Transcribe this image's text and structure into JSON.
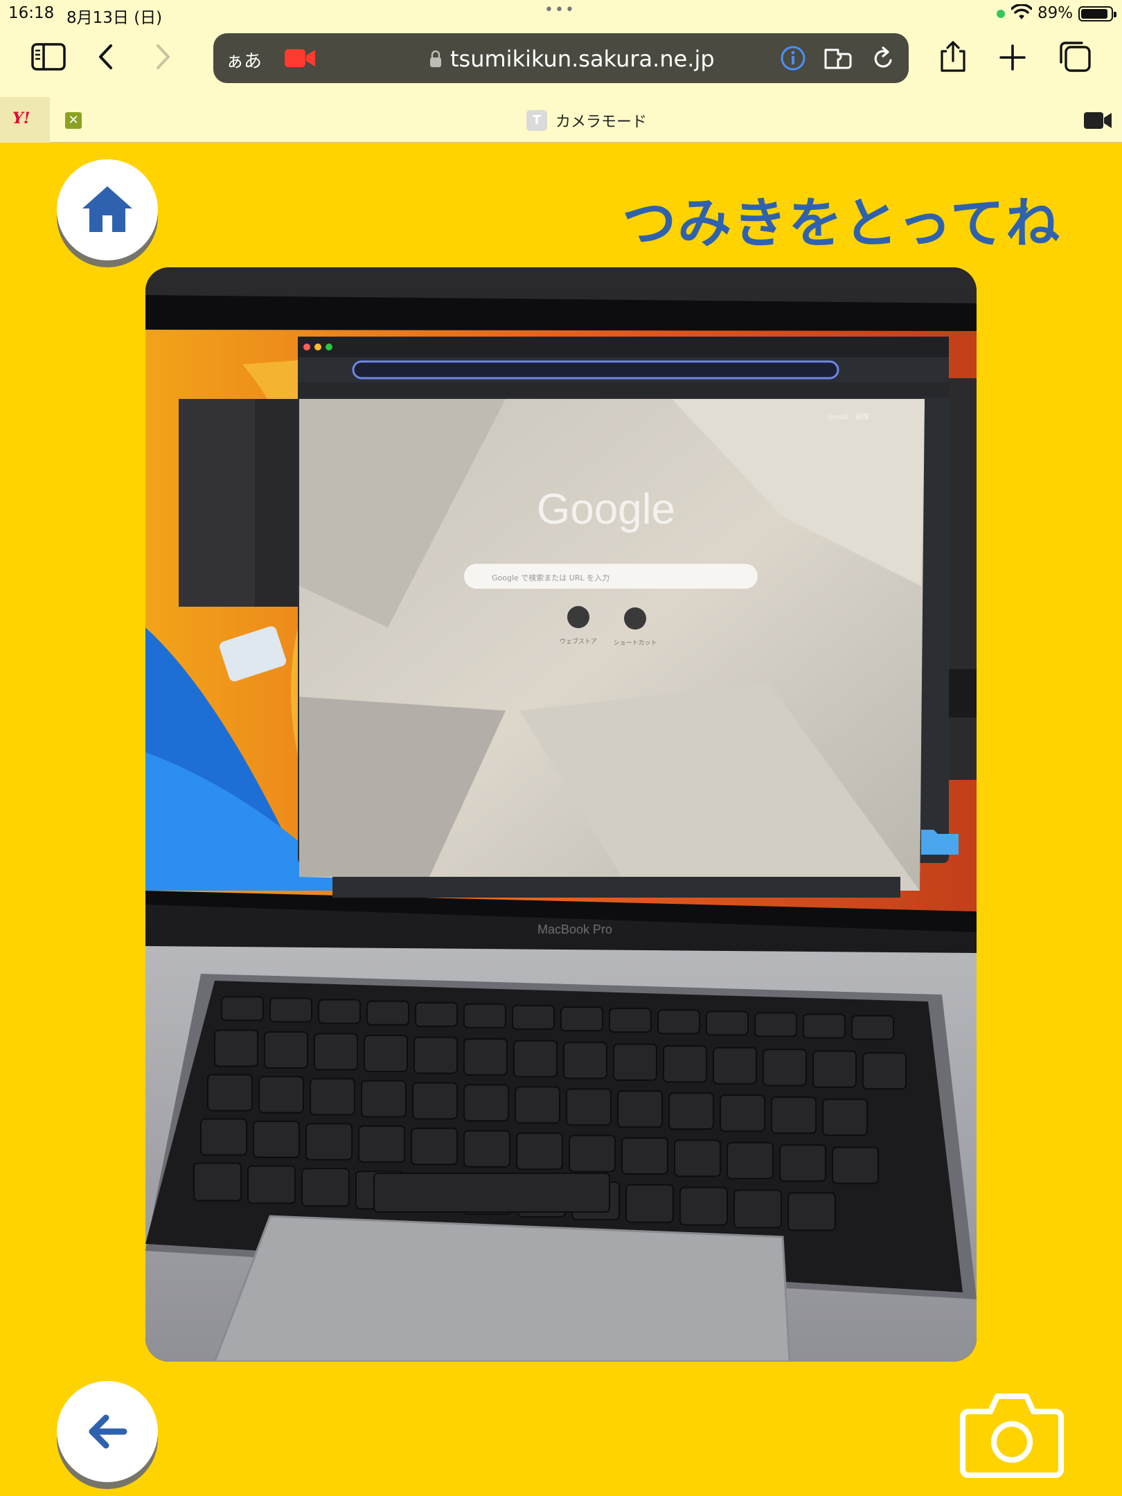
{
  "status_bar": {
    "time": "16:18",
    "date": "8月13日 (日)",
    "battery_percent": "89%",
    "battery_level": 0.89
  },
  "browser": {
    "text_size_label": "ぁあ",
    "url": "tsumikikun.sakura.ne.jp",
    "tabs": [
      {
        "label": "Y!",
        "icon": "yahoo-icon"
      },
      {
        "label": "✕",
        "icon": "x-favicon-icon"
      },
      {
        "label": "カメラモード",
        "favicon_letter": "T",
        "active": true
      }
    ]
  },
  "page": {
    "title": "つみきをとってね",
    "icons": {
      "home": "home-icon",
      "back": "arrow-left-icon",
      "shutter": "camera-icon"
    },
    "camera_feed": {
      "google_logo": "Google",
      "search_placeholder": "Google で検索または URL を入力",
      "laptop_label": "MacBook Pro",
      "gmail_link": "Gmail",
      "images_link": "画像",
      "shortcut_1": "ウェブストア",
      "shortcut_2": "ショートカット"
    }
  },
  "colors": {
    "page_background": "#FFD300",
    "accent_blue": "#2F62AE",
    "browser_chrome": "#FFFBC9",
    "address_bar": "#4A4A40"
  }
}
